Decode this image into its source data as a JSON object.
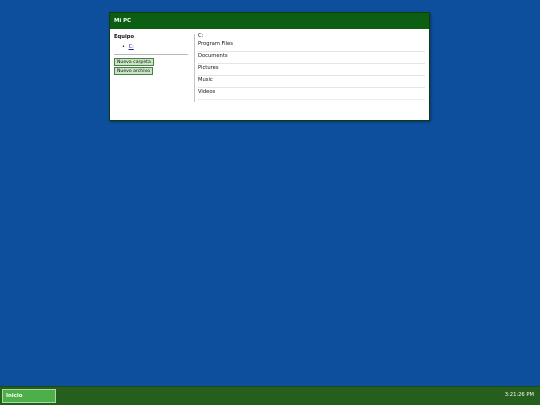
{
  "window": {
    "title": "Mi PC"
  },
  "sidebar": {
    "heading": "Equipo",
    "tree": [
      {
        "bullet": "•",
        "label": "C:"
      }
    ],
    "buttons": {
      "new_folder": "Nueva carpeta",
      "new_file": "Nuevo archivo"
    }
  },
  "main": {
    "path": "C:",
    "items": [
      {
        "label": "Program Files"
      },
      {
        "label": "Documents"
      },
      {
        "label": "Pictures"
      },
      {
        "label": "Music"
      },
      {
        "label": "Videos"
      }
    ]
  },
  "taskbar": {
    "start_label": "Inicio",
    "clock": "3:21:26 PM"
  },
  "colors": {
    "desktop": "#0d4f9c",
    "titlebar": "#0b5e12",
    "taskbar": "#265e1d",
    "start_button": "#4caf4a",
    "action_button": "#c7e6c4",
    "link": "#1a1aa6"
  }
}
